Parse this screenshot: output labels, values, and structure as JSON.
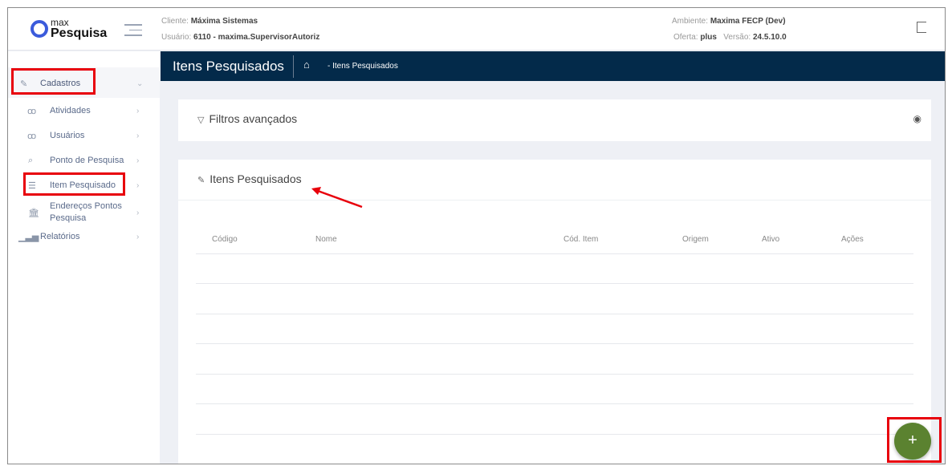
{
  "app": {
    "logo_top": "max",
    "logo_bottom": "Pesquisa"
  },
  "header": {
    "cliente_label": "Cliente:",
    "cliente": "Máxima Sistemas",
    "usuario_label": "Usuário:",
    "usuario": "6110 - maxima.SupervisorAutoriz",
    "ambiente_label": "Ambiente:",
    "ambiente": "Maxima FECP (Dev)",
    "oferta_label": "Oferta:",
    "oferta": "plus",
    "versao_label": "Versão:",
    "versao": "24.5.10.0"
  },
  "sidebar": {
    "items": [
      {
        "label": "Cadastros",
        "icon": "edit-icon"
      },
      {
        "label": "Atividades",
        "icon": "users-icon"
      },
      {
        "label": "Usuários",
        "icon": "users-icon"
      },
      {
        "label": "Ponto de Pesquisa",
        "icon": "search-location-icon"
      },
      {
        "label": "Item Pesquisado",
        "icon": "list-icon"
      },
      {
        "label": "Endereços Pontos Pesquisa",
        "icon": "bank-icon"
      },
      {
        "label": "Relatórios",
        "icon": "bar-chart-icon"
      }
    ]
  },
  "banner": {
    "title": "Itens Pesquisados",
    "breadcrumb": "- Itens Pesquisados"
  },
  "filters": {
    "title": "Filtros avançados"
  },
  "list": {
    "title": "Itens Pesquisados",
    "columns": [
      "Código",
      "Nome",
      "Cód. Item",
      "Origem",
      "Ativo",
      "Ações"
    ]
  },
  "fab": {
    "label": "+"
  },
  "colors": {
    "navy": "#032a4a",
    "fab": "#5b8230",
    "annotation": "#e8000b"
  }
}
